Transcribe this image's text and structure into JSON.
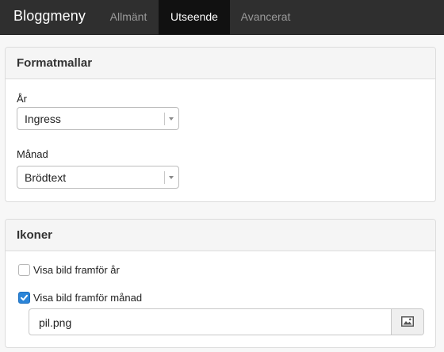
{
  "navbar": {
    "brand": "Bloggmeny",
    "tabs": [
      {
        "label": "Allmänt",
        "active": false
      },
      {
        "label": "Utseende",
        "active": true
      },
      {
        "label": "Avancerat",
        "active": false
      }
    ]
  },
  "formatmallar": {
    "title": "Formatmallar",
    "year": {
      "label": "År",
      "selected": "Ingress"
    },
    "month": {
      "label": "Månad",
      "selected": "Brödtext"
    }
  },
  "ikoner": {
    "title": "Ikoner",
    "show_image_year": {
      "label": "Visa bild framför år",
      "checked": false
    },
    "show_image_month": {
      "label": "Visa bild framför månad",
      "checked": true
    },
    "image_file": {
      "value": "pil.png",
      "button_icon": "image-icon"
    }
  },
  "colors": {
    "navbar_bg": "#2f2f2f",
    "active_tab_bg": "#111111",
    "checkbox_accent": "#2b85d8"
  }
}
